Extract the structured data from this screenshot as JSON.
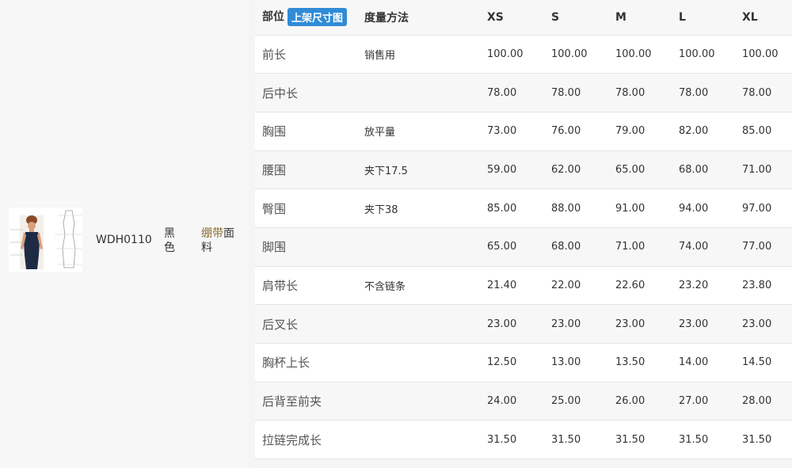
{
  "product": {
    "code": "WDH0110",
    "color": "黑色",
    "material_highlight": "绷带",
    "material_rest": "面料"
  },
  "table": {
    "header": {
      "part": "部位",
      "upload_button": "上架尺寸图",
      "method": "度量方法",
      "sizes": [
        "XS",
        "S",
        "M",
        "L",
        "XL"
      ]
    },
    "rows": [
      {
        "part": "前长",
        "method": "销售用",
        "values": [
          "100.00",
          "100.00",
          "100.00",
          "100.00",
          "100.00"
        ]
      },
      {
        "part": "后中长",
        "method": "",
        "values": [
          "78.00",
          "78.00",
          "78.00",
          "78.00",
          "78.00"
        ]
      },
      {
        "part": "胸围",
        "method": "放平量",
        "values": [
          "73.00",
          "76.00",
          "79.00",
          "82.00",
          "85.00"
        ]
      },
      {
        "part": "腰围",
        "method": "夹下17.5",
        "values": [
          "59.00",
          "62.00",
          "65.00",
          "68.00",
          "71.00"
        ]
      },
      {
        "part": "臀围",
        "method": "夹下38",
        "values": [
          "85.00",
          "88.00",
          "91.00",
          "94.00",
          "97.00"
        ]
      },
      {
        "part": "脚围",
        "method": "",
        "values": [
          "65.00",
          "68.00",
          "71.00",
          "74.00",
          "77.00"
        ]
      },
      {
        "part": "肩带长",
        "method": "不含链条",
        "values": [
          "21.40",
          "22.00",
          "22.60",
          "23.20",
          "23.80"
        ]
      },
      {
        "part": "后叉长",
        "method": "",
        "values": [
          "23.00",
          "23.00",
          "23.00",
          "23.00",
          "23.00"
        ]
      },
      {
        "part": "胸杯上长",
        "method": "",
        "values": [
          "12.50",
          "13.00",
          "13.50",
          "14.00",
          "14.50"
        ]
      },
      {
        "part": "后背至前夹",
        "method": "",
        "values": [
          "24.00",
          "25.00",
          "26.00",
          "27.00",
          "28.00"
        ]
      },
      {
        "part": "拉链完成长",
        "method": "",
        "values": [
          "31.50",
          "31.50",
          "31.50",
          "31.50",
          "31.50"
        ]
      }
    ]
  },
  "colors": {
    "badge": "#2f8bd6",
    "material_link": "#8a6a2f",
    "row_alt": "#f7f7f7",
    "border": "#e4e4e4"
  }
}
